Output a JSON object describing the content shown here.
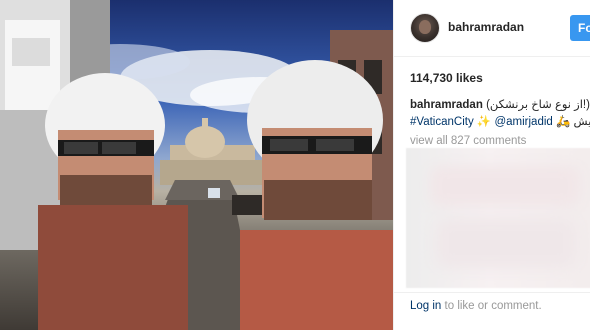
{
  "post": {
    "username": "bahramradan",
    "follow_label": "Fo",
    "likes": "114,730 likes",
    "caption": {
      "user": "bahramradan",
      "line1_text": "(از نوع شاخ برنشکن!) یدی جان",
      "hashtag": "#VaticanCity",
      "mention": "@amirjadid",
      "line2_tail": "جلدی پیش"
    },
    "view_all": "view all 827 comments",
    "login": {
      "link": "Log in",
      "rest": " to like or comment."
    }
  },
  "icons": {
    "avatar": "profile-avatar",
    "emoji": "sparkles-icon",
    "motorbike": "scooter-emoji-icon"
  },
  "colors": {
    "follow_blue": "#3897f0",
    "link_blue": "#003569",
    "muted_text": "#999999",
    "text": "#262626"
  }
}
